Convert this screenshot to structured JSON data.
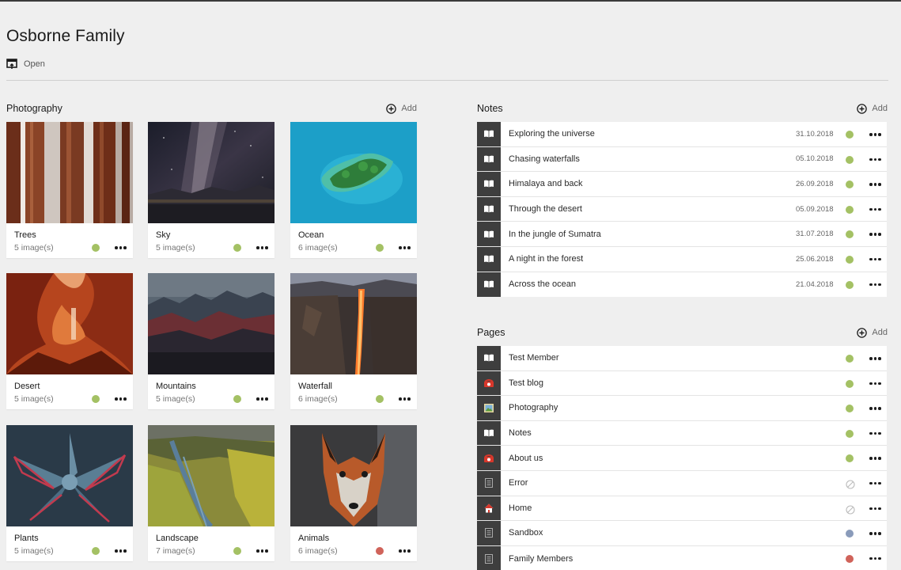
{
  "header": {
    "title": "Osborne Family",
    "open_label": "Open"
  },
  "photography": {
    "title": "Photography",
    "add_label": "Add",
    "cards": [
      {
        "name": "Trees",
        "count": "5 image(s)",
        "status": "#a4c164"
      },
      {
        "name": "Sky",
        "count": "5 image(s)",
        "status": "#a4c164"
      },
      {
        "name": "Ocean",
        "count": "6 image(s)",
        "status": "#a4c164"
      },
      {
        "name": "Desert",
        "count": "5 image(s)",
        "status": "#a4c164"
      },
      {
        "name": "Mountains",
        "count": "5 image(s)",
        "status": "#a4c164"
      },
      {
        "name": "Waterfall",
        "count": "6 image(s)",
        "status": "#a4c164"
      },
      {
        "name": "Plants",
        "count": "5 image(s)",
        "status": "#a4c164"
      },
      {
        "name": "Landscape",
        "count": "7 image(s)",
        "status": "#a4c164"
      },
      {
        "name": "Animals",
        "count": "6 image(s)",
        "status": "#d0635a"
      }
    ]
  },
  "notes": {
    "title": "Notes",
    "add_label": "Add",
    "items": [
      {
        "label": "Exploring the universe",
        "date": "31.10.2018",
        "icon": "book-icon",
        "status": "#a4c164"
      },
      {
        "label": "Chasing waterfalls",
        "date": "05.10.2018",
        "icon": "book-icon",
        "status": "#a4c164"
      },
      {
        "label": "Himalaya and back",
        "date": "26.09.2018",
        "icon": "book-icon",
        "status": "#a4c164"
      },
      {
        "label": "Through the desert",
        "date": "05.09.2018",
        "icon": "book-icon",
        "status": "#a4c164"
      },
      {
        "label": "In the jungle of Sumatra",
        "date": "31.07.2018",
        "icon": "book-icon",
        "status": "#a4c164"
      },
      {
        "label": "A night in the forest",
        "date": "25.06.2018",
        "icon": "book-icon",
        "status": "#a4c164"
      },
      {
        "label": "Across the ocean",
        "date": "21.04.2018",
        "icon": "book-icon",
        "status": "#a4c164"
      }
    ]
  },
  "pages": {
    "title": "Pages",
    "add_label": "Add",
    "items": [
      {
        "label": "Test Member",
        "icon": "book-icon",
        "status": "#a4c164"
      },
      {
        "label": "Test blog",
        "icon": "phone-icon",
        "status": "#a4c164"
      },
      {
        "label": "Photography",
        "icon": "picture-icon",
        "status": "#a4c164"
      },
      {
        "label": "Notes",
        "icon": "book-icon",
        "status": "#a4c164"
      },
      {
        "label": "About us",
        "icon": "phone-icon",
        "status": "#a4c164"
      },
      {
        "label": "Error",
        "icon": "document-icon",
        "status": "none"
      },
      {
        "label": "Home",
        "icon": "home-icon",
        "status": "none"
      },
      {
        "label": "Sandbox",
        "icon": "document-icon",
        "status": "#8a9bba"
      },
      {
        "label": "Family Members",
        "icon": "document-icon",
        "status": "#d0635a"
      }
    ]
  }
}
